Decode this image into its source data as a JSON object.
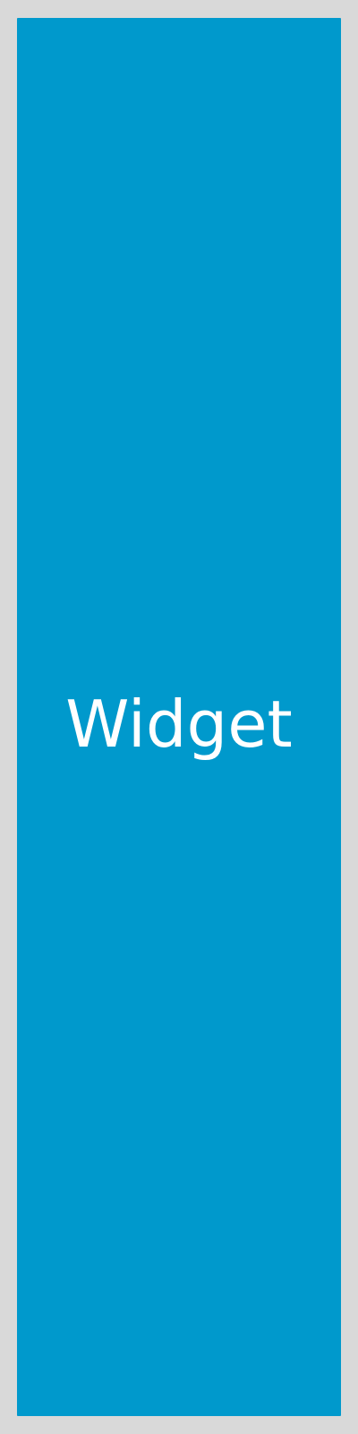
{
  "widget": {
    "label": "Widget",
    "colors": {
      "background": "#0099cc",
      "text": "#ffffff",
      "page": "#d9d9d9"
    }
  }
}
